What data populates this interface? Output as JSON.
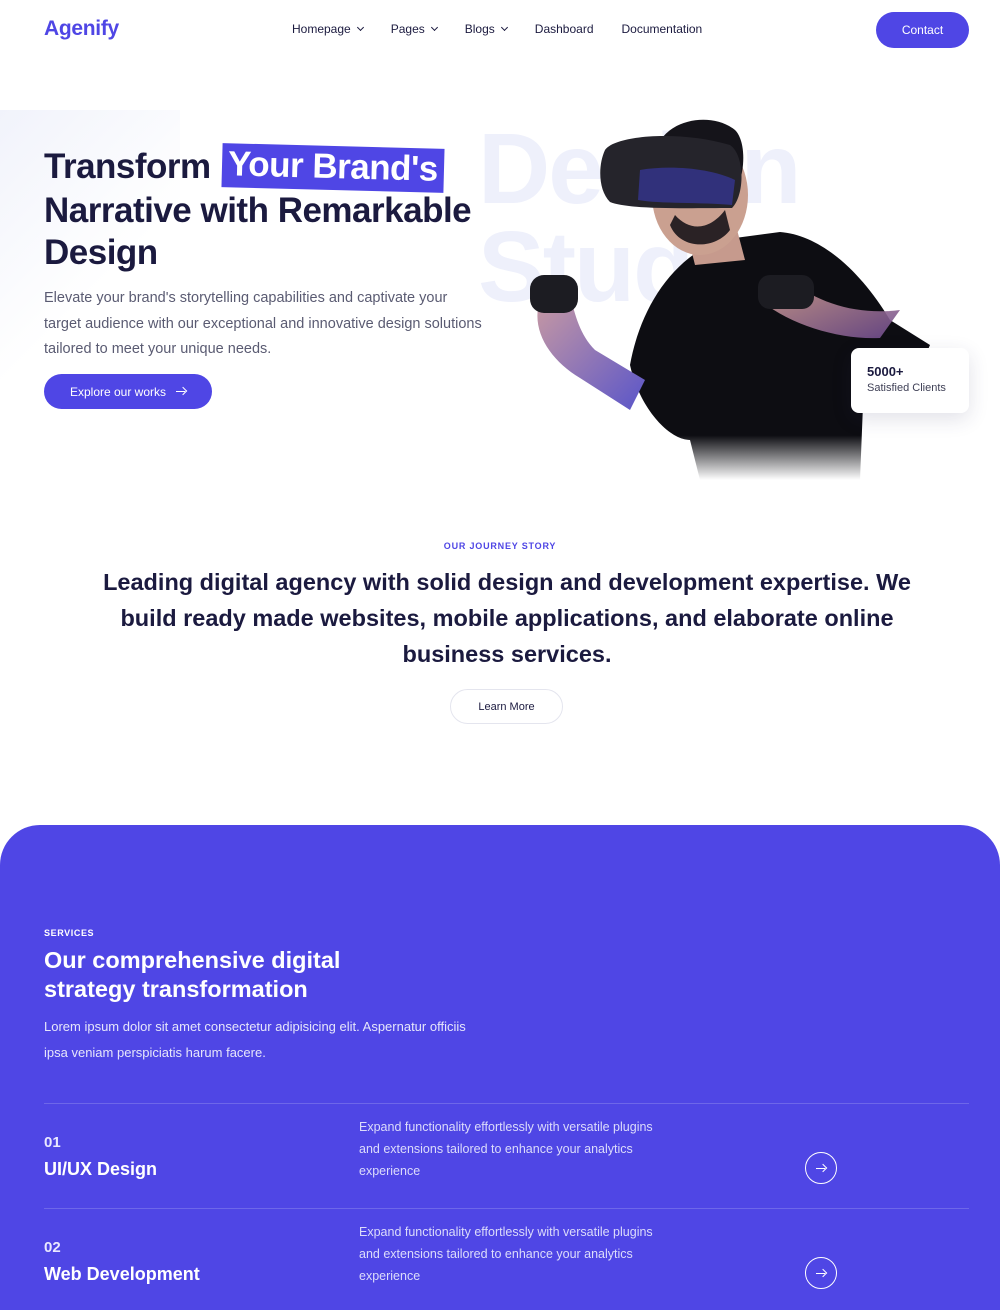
{
  "brand": {
    "logo": "Agenify",
    "accent": "#4f46e5"
  },
  "nav": {
    "items": [
      {
        "label": "Homepage",
        "dropdown": true
      },
      {
        "label": "Pages",
        "dropdown": true
      },
      {
        "label": "Blogs",
        "dropdown": true
      },
      {
        "label": "Dashboard",
        "dropdown": false
      },
      {
        "label": "Documentation",
        "dropdown": false
      }
    ],
    "contact_label": "Contact"
  },
  "hero": {
    "title_pre": "Transform",
    "title_highlight": "Your Brand's",
    "title_post": "Narrative with Remarkable Design",
    "subtitle": "Elevate your brand's storytelling capabilities and captivate your target audience with our exceptional and innovative design solutions tailored to meet your unique needs.",
    "cta_label": "Explore our works",
    "watermark": "Design\nStudio",
    "stat_value": "5000+",
    "stat_label": "Satisfied Clients"
  },
  "story": {
    "kicker": "OUR JOURNEY STORY",
    "title": "Leading digital agency with solid design and development expertise. We build ready made websites, mobile applications, and elaborate online business services.",
    "button_label": "Learn More"
  },
  "services": {
    "kicker": "SERVICES",
    "title": "Our comprehensive digital strategy transformation",
    "subtitle": "Lorem ipsum dolor sit amet consectetur adipisicing elit. Aspernatur officiis ipsa veniam perspiciatis harum facere.",
    "items": [
      {
        "number": "01",
        "name": "UI/UX Design",
        "description": "Expand functionality effortlessly with versatile plugins and extensions tailored to enhance your analytics experience"
      },
      {
        "number": "02",
        "name": "Web Development",
        "description": "Expand functionality effortlessly with versatile plugins and extensions tailored to enhance your analytics experience"
      }
    ]
  }
}
